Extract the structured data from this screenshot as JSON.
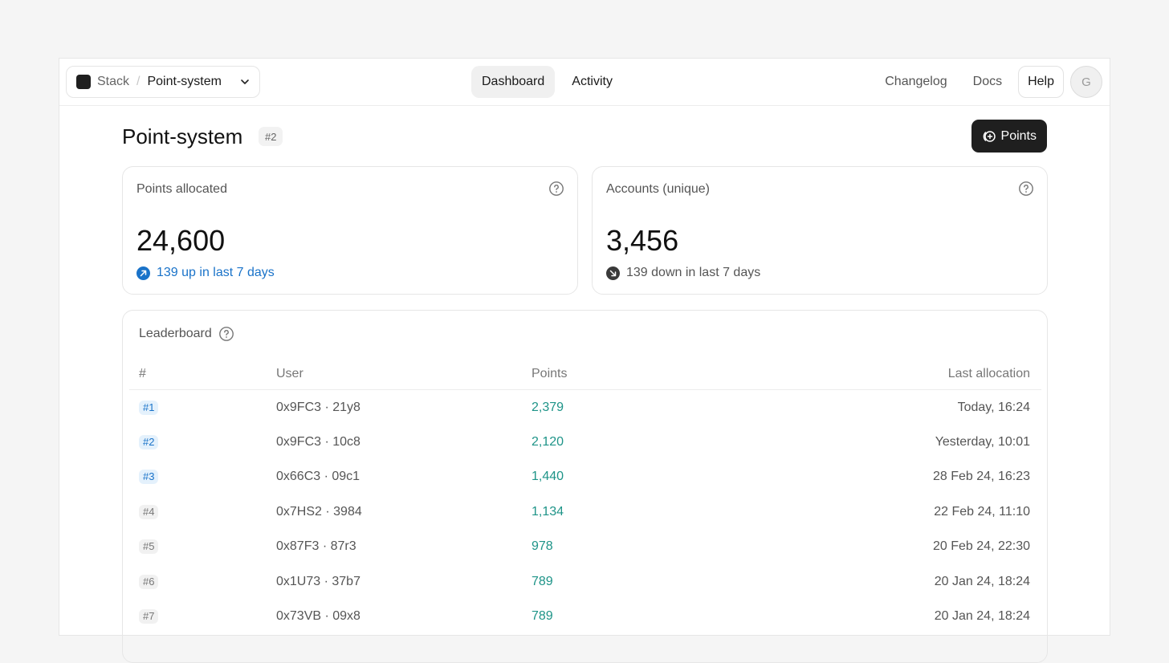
{
  "header": {
    "org": "Stack",
    "separator": "/",
    "project": "Point-system",
    "tabs": [
      {
        "label": "Dashboard",
        "active": true
      },
      {
        "label": "Activity",
        "active": false
      }
    ],
    "links": [
      "Changelog",
      "Docs"
    ],
    "help_label": "Help",
    "avatar_initial": "G"
  },
  "page": {
    "title": "Point-system",
    "id_badge": "#2",
    "points_button_label": "Points"
  },
  "stats": [
    {
      "label": "Points allocated",
      "value": "24,600",
      "trend": "139 up in last 7 days",
      "direction": "up"
    },
    {
      "label": "Accounts (unique)",
      "value": "3,456",
      "trend": "139 down in last 7 days",
      "direction": "down"
    }
  ],
  "leaderboard": {
    "title": "Leaderboard",
    "columns": {
      "rank": "#",
      "user": "User",
      "points": "Points",
      "last": "Last allocation"
    },
    "rows": [
      {
        "rank": "#1",
        "user": "0x9FC3 · 21y8",
        "points": "2,379",
        "last": "Today, 16:24"
      },
      {
        "rank": "#2",
        "user": "0x9FC3 · 10c8",
        "points": "2,120",
        "last": "Yesterday, 10:01"
      },
      {
        "rank": "#3",
        "user": "0x66C3 · 09c1",
        "points": "1,440",
        "last": "28 Feb 24, 16:23"
      },
      {
        "rank": "#4",
        "user": "0x7HS2 · 3984",
        "points": "1,134",
        "last": "22 Feb 24, 11:10"
      },
      {
        "rank": "#5",
        "user": "0x87F3 · 87r3",
        "points": "978",
        "last": "20 Feb 24, 22:30"
      },
      {
        "rank": "#6",
        "user": "0x1U73 · 37b7",
        "points": "789",
        "last": "20 Jan 24, 18:24"
      },
      {
        "rank": "#7",
        "user": "0x73VB · 09x8",
        "points": "789",
        "last": "20 Jan 24, 18:24"
      }
    ]
  },
  "colors": {
    "accent_blue": "#1a73c9",
    "points_teal": "#1e9488",
    "dark_button": "#1f1f1f"
  }
}
